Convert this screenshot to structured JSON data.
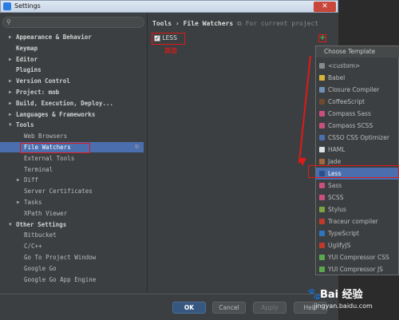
{
  "window": {
    "title": "Settings",
    "close_glyph": "✕"
  },
  "search": {
    "placeholder": "",
    "value": ""
  },
  "tree": [
    {
      "label": "Appearance & Behavior",
      "bold": true,
      "arrow": "▶",
      "indent": 0
    },
    {
      "label": "Keymap",
      "bold": true,
      "arrow": "",
      "indent": 0
    },
    {
      "label": "Editor",
      "bold": true,
      "arrow": "▶",
      "indent": 0
    },
    {
      "label": "Plugins",
      "bold": true,
      "arrow": "",
      "indent": 0
    },
    {
      "label": "Version Control",
      "bold": true,
      "arrow": "▶",
      "indent": 0
    },
    {
      "label": "Project: mob",
      "bold": true,
      "arrow": "▶",
      "indent": 0
    },
    {
      "label": "Build, Execution, Deploy...",
      "bold": true,
      "arrow": "▶",
      "indent": 0
    },
    {
      "label": "Languages & Frameworks",
      "bold": true,
      "arrow": "▶",
      "indent": 0
    },
    {
      "label": "Tools",
      "bold": true,
      "arrow": "▼",
      "indent": 0
    },
    {
      "label": "Web Browsers",
      "bold": false,
      "arrow": "",
      "indent": 1
    },
    {
      "label": "File Watchers",
      "bold": false,
      "arrow": "",
      "indent": 1,
      "selected": true
    },
    {
      "label": "External Tools",
      "bold": false,
      "arrow": "",
      "indent": 1
    },
    {
      "label": "Terminal",
      "bold": false,
      "arrow": "",
      "indent": 1
    },
    {
      "label": "Diff",
      "bold": false,
      "arrow": "▶",
      "indent": 1
    },
    {
      "label": "Server Certificates",
      "bold": false,
      "arrow": "",
      "indent": 1
    },
    {
      "label": "Tasks",
      "bold": false,
      "arrow": "▶",
      "indent": 1
    },
    {
      "label": "XPath Viewer",
      "bold": false,
      "arrow": "",
      "indent": 1
    },
    {
      "label": "Other Settings",
      "bold": true,
      "arrow": "▼",
      "indent": 0
    },
    {
      "label": "Bitbucket",
      "bold": false,
      "arrow": "",
      "indent": 1
    },
    {
      "label": "C/C++",
      "bold": false,
      "arrow": "",
      "indent": 1
    },
    {
      "label": "Go To Project Window",
      "bold": false,
      "arrow": "",
      "indent": 1
    },
    {
      "label": "Google Go",
      "bold": false,
      "arrow": "",
      "indent": 1
    },
    {
      "label": "Google Go App Engine",
      "bold": false,
      "arrow": "",
      "indent": 1
    }
  ],
  "breadcrumb": {
    "parent": "Tools",
    "separator": "›",
    "current": "File Watchers",
    "scope_icon": "⧉",
    "scope_text": "For current project"
  },
  "watcher": {
    "checked_glyph": "✓",
    "name": "LESS"
  },
  "annotation": {
    "label": "双击"
  },
  "add_button": {
    "glyph": "+"
  },
  "popup": {
    "header": "Choose Template",
    "items": [
      {
        "label": "<custom>",
        "color": "#8a8a8a"
      },
      {
        "label": "Babel",
        "color": "#d8b43a"
      },
      {
        "label": "Closure Compiler",
        "color": "#6f8fb5"
      },
      {
        "label": "CoffeeScript",
        "color": "#6e4a2e"
      },
      {
        "label": "Compass Sass",
        "color": "#c94f7c"
      },
      {
        "label": "Compass SCSS",
        "color": "#c94f7c"
      },
      {
        "label": "CSSO CSS Optimizer",
        "color": "#4b6eaf"
      },
      {
        "label": "HAML",
        "color": "#e0e0e0"
      },
      {
        "label": "Jade",
        "color": "#a2673c"
      },
      {
        "label": "Less",
        "color": "#2a4f8a",
        "selected": true
      },
      {
        "label": "Sass",
        "color": "#c94f7c"
      },
      {
        "label": "SCSS",
        "color": "#c94f7c"
      },
      {
        "label": "Stylus",
        "color": "#7da342"
      },
      {
        "label": "Traceur compiler",
        "color": "#c0392b"
      },
      {
        "label": "TypeScript",
        "color": "#2f74c0"
      },
      {
        "label": "UglifyJS",
        "color": "#c0392b"
      },
      {
        "label": "YUI Compressor CSS",
        "color": "#5aa84c"
      },
      {
        "label": "YUI Compressor JS",
        "color": "#5aa84c"
      }
    ]
  },
  "footer": {
    "ok": "OK",
    "cancel": "Cancel",
    "apply": "Apply",
    "help": "Help"
  },
  "watermark": {
    "brand": "Bai 经验",
    "url": "jingyan.baidu.com"
  },
  "colors": {
    "accent": "#4b6eaf",
    "annotation": "#e01919",
    "ok_button": "#365880"
  }
}
